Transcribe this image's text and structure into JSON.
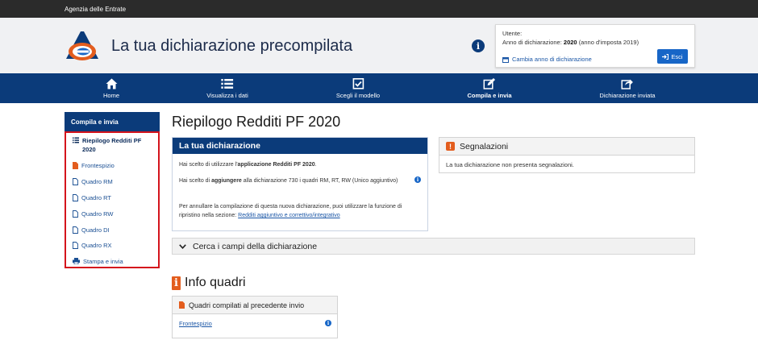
{
  "topbar": {
    "org": "Agenzia delle Entrate"
  },
  "header": {
    "title": "La tua dichiarazione precompilata",
    "user_label": "Utente:",
    "anno_prefix": "Anno di dichiarazione:",
    "anno_value": "2020",
    "anno_suffix": "(anno d'imposta 2019)",
    "cambia": "Cambia anno di dichiarazione",
    "esci": "Esci"
  },
  "nav": {
    "items": [
      {
        "label": "Home",
        "icon": "home-icon"
      },
      {
        "label": "Visualizza i dati",
        "icon": "list-icon"
      },
      {
        "label": "Scegli il modello",
        "icon": "checkbox-icon"
      },
      {
        "label": "Compila e invia",
        "icon": "edit-icon",
        "active": true
      },
      {
        "label": "Dichiarazione inviata",
        "icon": "share-icon"
      }
    ]
  },
  "sidebar": {
    "title": "Compila e invia",
    "items": [
      {
        "label": "Riepilogo Redditi PF 2020",
        "active": true,
        "icon": "list-icon"
      },
      {
        "label": "Frontespizio",
        "icon": "document-orange-icon"
      },
      {
        "label": "Quadro RM",
        "icon": "document-icon"
      },
      {
        "label": "Quadro RT",
        "icon": "document-icon"
      },
      {
        "label": "Quadro RW",
        "icon": "document-icon"
      },
      {
        "label": "Quadro DI",
        "icon": "document-icon"
      },
      {
        "label": "Quadro RX",
        "icon": "document-icon"
      },
      {
        "label": "Stampa e invia",
        "icon": "print-icon"
      }
    ]
  },
  "main": {
    "page_title": "Riepilogo Redditi PF 2020",
    "dich_card": {
      "title": "La tua dichiarazione",
      "p1_pre": "Hai scelto di utilizzare l'",
      "p1_bold": "applicazione Redditi PF 2020",
      "p1_post": ".",
      "p2_pre": "Hai scelto di ",
      "p2_bold": "aggiungere",
      "p2_post": " alla dichiarazione 730 i quadri RM, RT, RW (Unico aggiuntivo)",
      "p3": "Per annullare la compilazione di questa nuova dichiarazione, puoi utilizzare la funzione di ripristino nella sezione: ",
      "p3_link": "Redditi aggiuntivo e correttivo/integrativo"
    },
    "segn_card": {
      "title": "Segnalazioni",
      "body": "La tua dichiarazione non presenta segnalazioni."
    },
    "cerca": "Cerca i campi della dichiarazione",
    "info_quadri": "Info quadri",
    "qc_card": {
      "title": "Quadri compilati al precedente invio",
      "link": "Frontespizio"
    }
  },
  "colors": {
    "navy": "#0b3b7a",
    "accent": "#e35d1e",
    "link": "#1a56a6",
    "highlight": "#d4141c"
  }
}
